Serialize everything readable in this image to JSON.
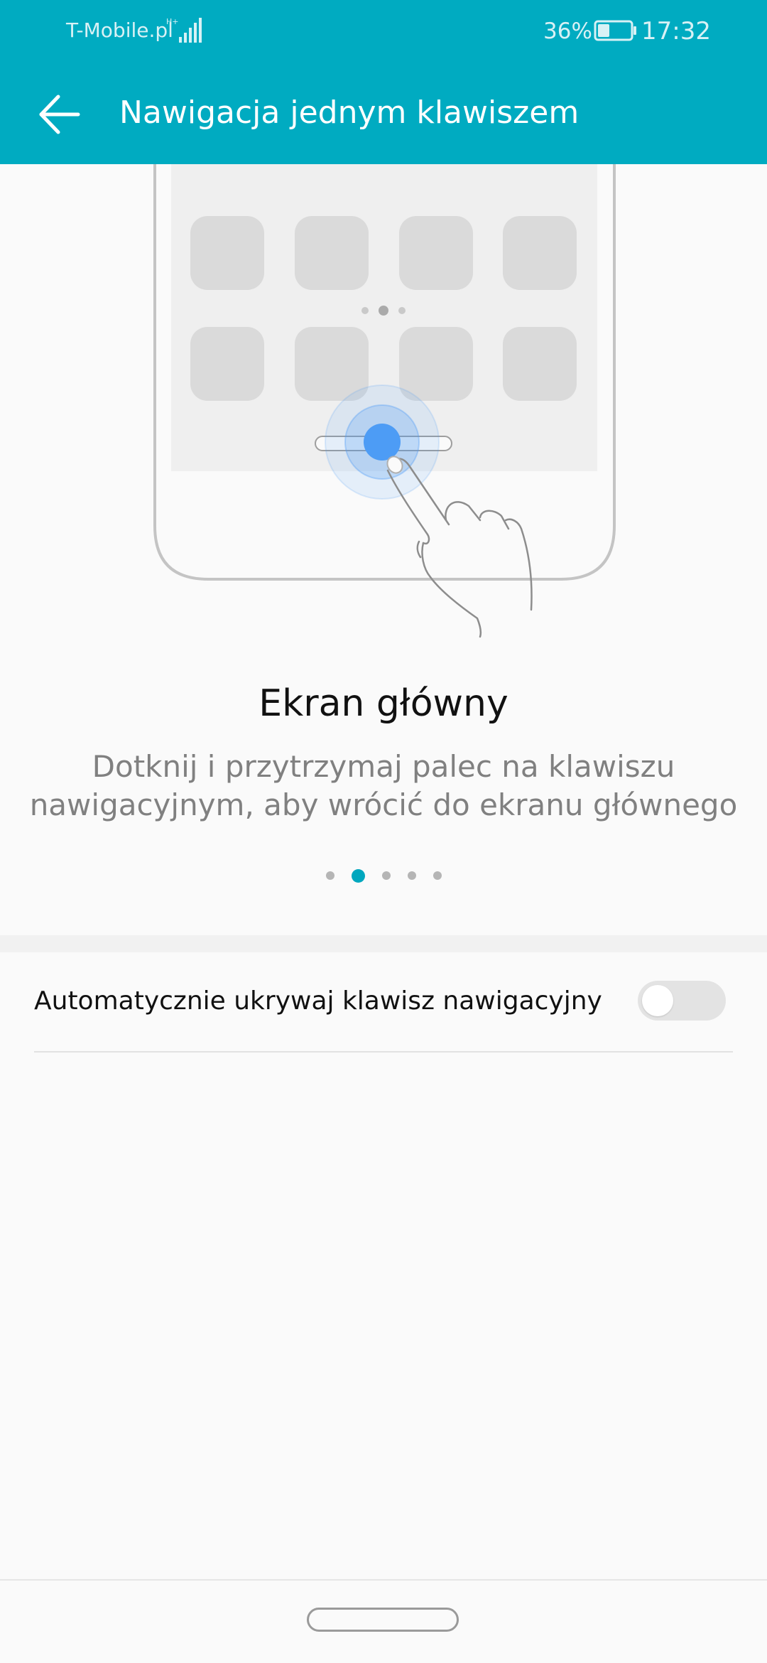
{
  "status_bar": {
    "carrier": "T-Mobile.pl",
    "network_type": "H+",
    "battery_percent": "36%",
    "time": "17:32"
  },
  "app_bar": {
    "title": "Nawigacja jednym klawiszem",
    "back_icon": "arrow-left-icon"
  },
  "slide": {
    "title": "Ekran główny",
    "description": "Dotknij i przytrzymaj palec na klawiszu nawigacyjnym, aby wrócić do ekranu głównego",
    "total": 5,
    "active_index": 1
  },
  "settings": [
    {
      "label": "Automatycznie ukrywaj klawisz nawigacyjny",
      "enabled": false
    }
  ],
  "colors": {
    "accent": "#00abc1",
    "touch_point": "#4d9cf5"
  }
}
